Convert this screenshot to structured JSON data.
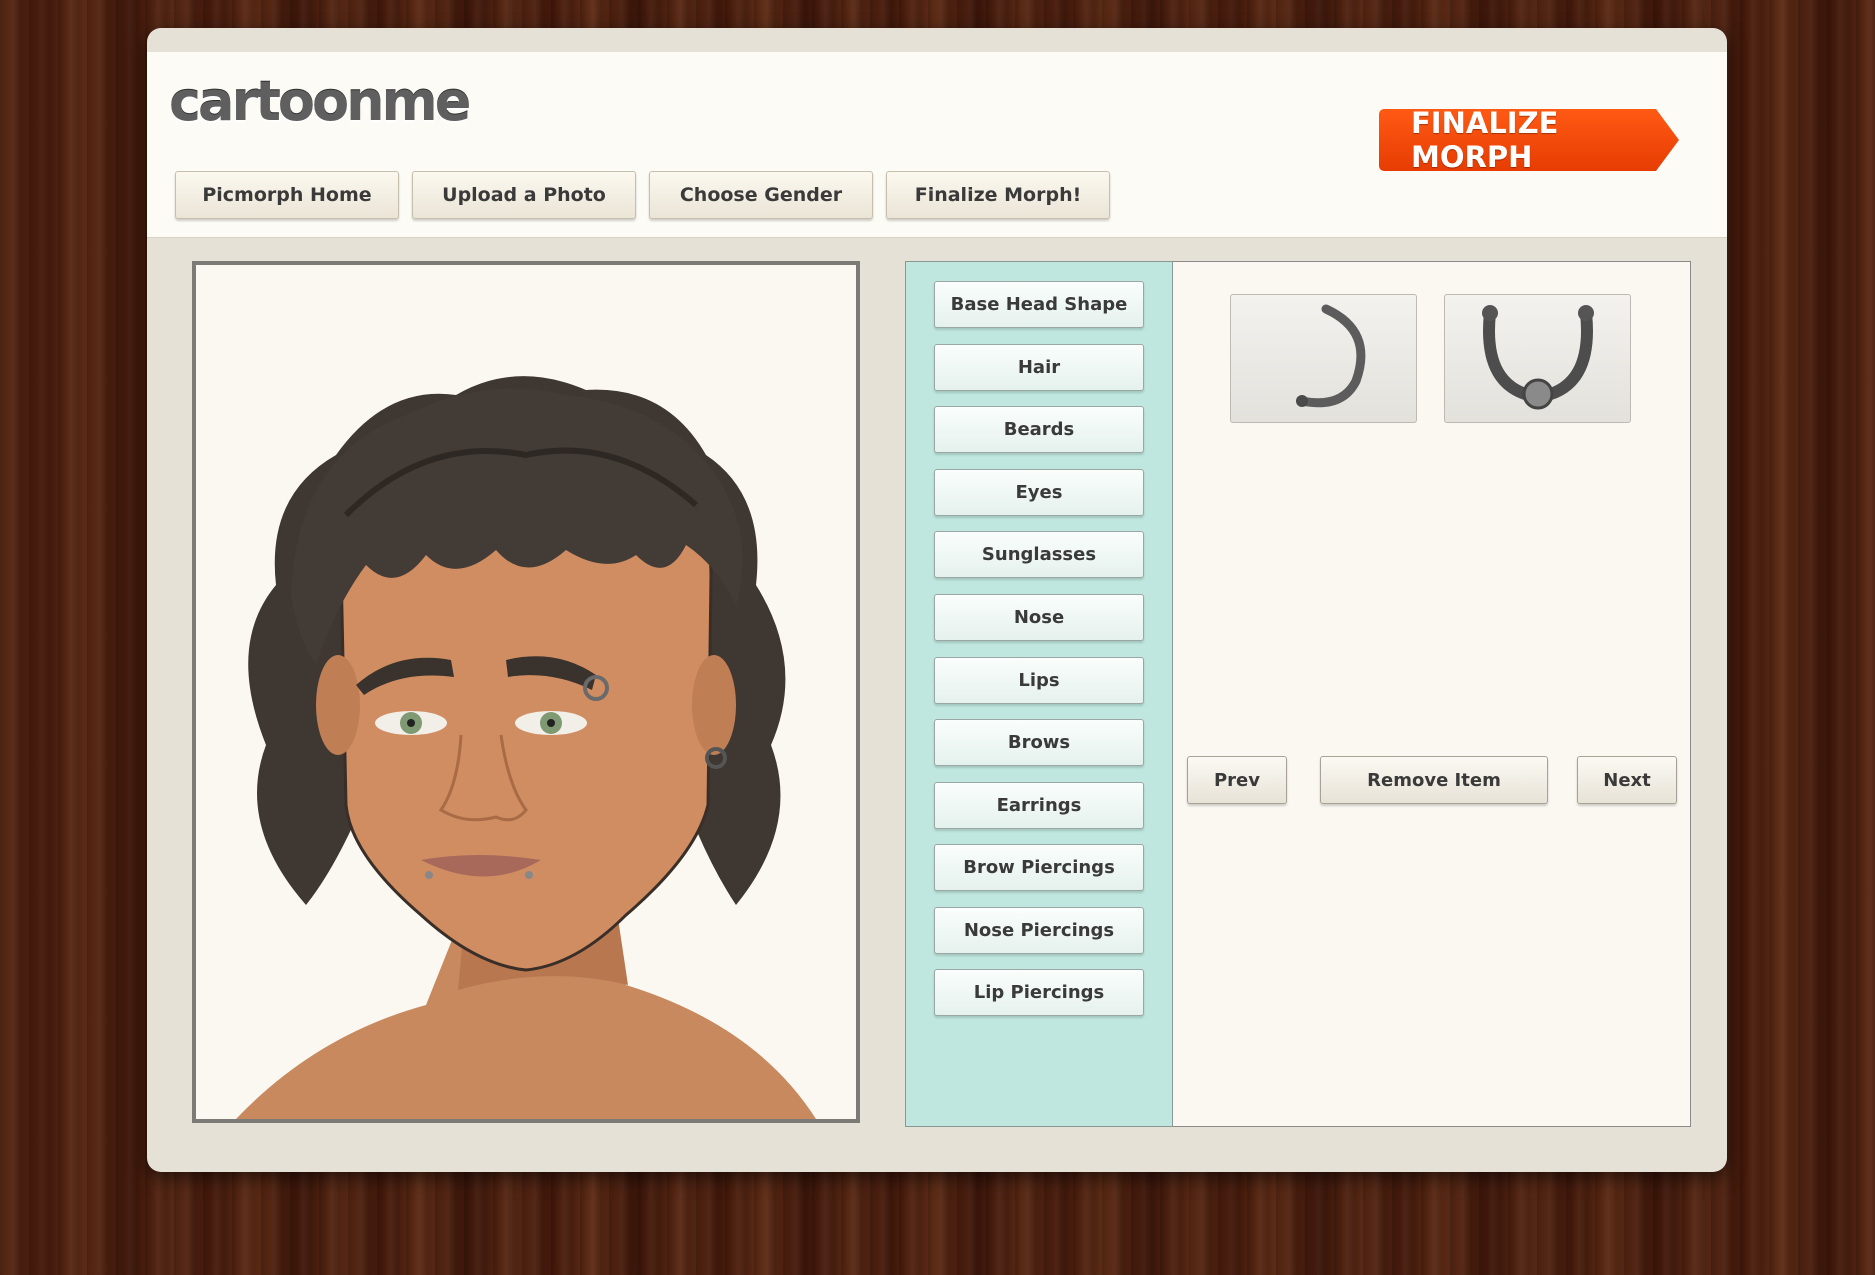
{
  "header": {
    "logo_text": "cartoonme",
    "finalize_banner": "FINALIZE MORPH",
    "nav": [
      {
        "label": "Picmorph Home"
      },
      {
        "label": "Upload a Photo"
      },
      {
        "label": "Choose Gender"
      },
      {
        "label": "Finalize Morph!"
      }
    ]
  },
  "categories": [
    {
      "label": "Base Head Shape"
    },
    {
      "label": "Hair"
    },
    {
      "label": "Beards"
    },
    {
      "label": "Eyes"
    },
    {
      "label": "Sunglasses"
    },
    {
      "label": "Nose"
    },
    {
      "label": "Lips"
    },
    {
      "label": "Brows"
    },
    {
      "label": "Earrings"
    },
    {
      "label": "Brow Piercings"
    },
    {
      "label": "Nose Piercings"
    },
    {
      "label": "Lip Piercings"
    }
  ],
  "items": {
    "thumbnails": [
      {
        "icon": "curved-ring-piercing-icon"
      },
      {
        "icon": "horseshoe-ball-piercing-icon"
      }
    ],
    "controls": {
      "prev": "Prev",
      "remove": "Remove Item",
      "next": "Next"
    }
  },
  "colors": {
    "accent": "#e94a06",
    "category_panel": "#bfe7df",
    "panel_bg": "#e6e1d7",
    "hair": "#3e3732",
    "skin": "#c98a5f"
  }
}
